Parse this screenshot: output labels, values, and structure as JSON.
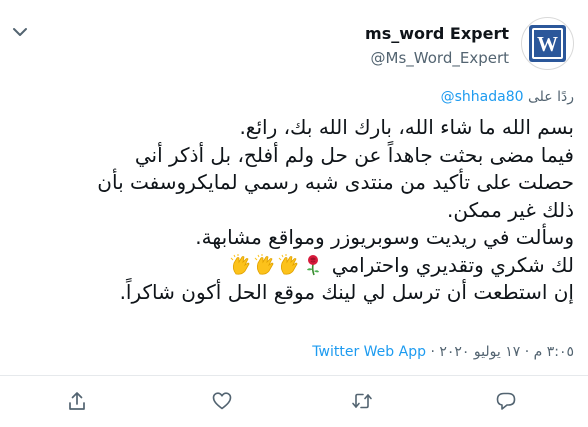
{
  "author": {
    "display_name": "ms_word Expert",
    "handle": "@Ms_Word_Expert",
    "avatar_icon": "word-logo-icon",
    "avatar_letter": "W"
  },
  "reply": {
    "prefix": "ردًا على",
    "mention": "@shhada80"
  },
  "body": {
    "line1": "بسم الله ما شاء الله، بارك الله بك، رائع.",
    "line2": "فيما مضى بحثت جاهداً عن حل ولم أفلح، بل أذكر أني",
    "line3": "حصلت على تأكيد من منتدى شبه رسمي لمايكروسفت بأن",
    "line4": "ذلك غير ممكن.",
    "line5": "وسألت في ريديت وسوبريوزر ومواقع مشابهة.",
    "line6": "لك شكري وتقديري واحترامي",
    "line7": "إن استطعت أن ترسل لي لينك موقع الحل أكون شاكراً."
  },
  "emojis": [
    "rose-icon",
    "clapping-hands-icon",
    "clapping-hands-icon",
    "clapping-hands-icon"
  ],
  "meta": {
    "time": "٣:٠٥ م",
    "separator": "·",
    "date": "١٧ يوليو ٢٠٢٠",
    "source": "Twitter Web App"
  },
  "actions": [
    "share-icon",
    "like-icon",
    "retweet-icon",
    "reply-icon"
  ],
  "colors": {
    "link": "#1d9bf0",
    "secondary_text": "#536471",
    "primary_text": "#0f1419",
    "word_blue": "#2b579a"
  }
}
